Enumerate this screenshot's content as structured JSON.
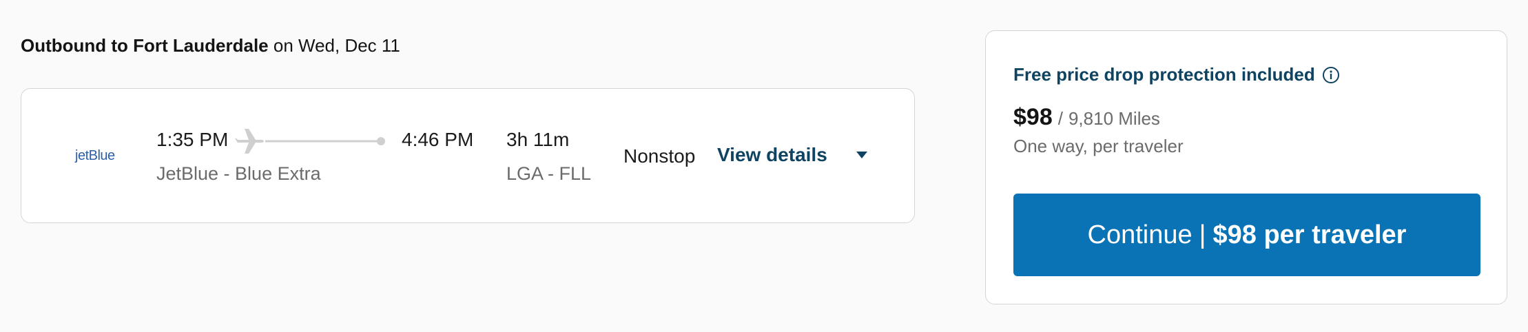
{
  "heading": {
    "bold": "Outbound to Fort Lauderdale",
    "rest": " on Wed, Dec 11"
  },
  "flight": {
    "airline_logo": "jetBlue",
    "depart_time": "1:35 PM",
    "arrive_time": "4:46 PM",
    "fare_class": "JetBlue - Blue Extra",
    "duration": "3h 11m",
    "airports": "LGA - FLL",
    "stops": "Nonstop",
    "view_details": "View details"
  },
  "price": {
    "protection": "Free price drop protection included",
    "amount": "$98",
    "separator": "/",
    "miles": "9,810 Miles",
    "per_traveler": "One way, per traveler",
    "continue_label": "Continue",
    "continue_sep": "|",
    "continue_price": "$98 per traveler"
  },
  "colors": {
    "accent_dark": "#0e4361",
    "button": "#0a73b5",
    "muted": "#6b6b6b",
    "background": "#fafafa"
  },
  "icons": {
    "plane": "plane-icon",
    "info": "info-icon",
    "caret": "chevron-down-icon"
  }
}
